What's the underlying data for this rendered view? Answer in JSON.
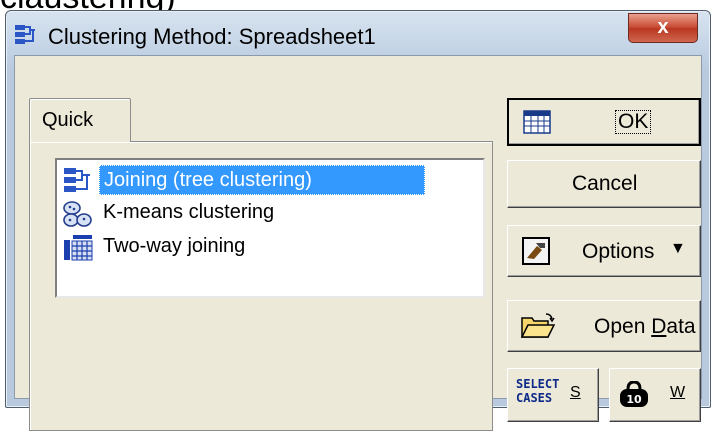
{
  "background_text": "claustering)",
  "window": {
    "title": "Clustering Method: Spreadsheet1",
    "close_label": "x"
  },
  "tabs": [
    {
      "label": "Quick"
    }
  ],
  "methods": [
    {
      "label": "Joining (tree clustering)",
      "icon": "tree-clustering-icon",
      "selected": true
    },
    {
      "label": "K-means clustering",
      "icon": "kmeans-icon",
      "selected": false
    },
    {
      "label": "Two-way joining",
      "icon": "two-way-joining-icon",
      "selected": false
    }
  ],
  "buttons": {
    "ok_label": "OK",
    "cancel_label": "Cancel",
    "options_label": "Options",
    "open_data_pre": "Open ",
    "open_data_key": "D",
    "open_data_post": "ata",
    "select_cases_line1": "SELECT",
    "select_cases_line2": "CASES",
    "select_cases_key": "S",
    "weight_key": "W"
  },
  "colors": {
    "selection": "#3399ff",
    "dialog_face": "#ece9d8",
    "close_button": "#c6452e"
  }
}
